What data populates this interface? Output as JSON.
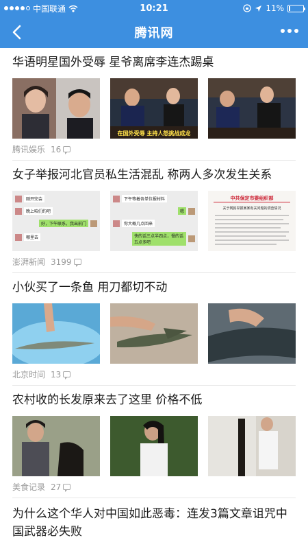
{
  "status_bar": {
    "carrier": "中国联通",
    "time": "10:21",
    "battery": "11%",
    "battery_level": 0.11
  },
  "nav": {
    "title": "腾讯网",
    "back_icon": "chevron-left-icon",
    "more_icon": "more-dots-icon"
  },
  "articles": [
    {
      "headline": "华语明星国外受辱 星爷离席李连杰踢桌",
      "source": "腾讯娱乐",
      "comments": "16"
    },
    {
      "headline": "女子举报河北官员私生活混乱 称两人多次发生关系",
      "source": "澎湃新闻",
      "comments": "3199",
      "chat_lines": [
        "刚开完会",
        "晚上咱们约吧",
        "好，下午联系，我出前门",
        "哪里去",
        "下午等着各单位报材料",
        "嗯",
        "你大概几点回来",
        "快的话三点半四点，慢的话五点多吧"
      ],
      "doc_title": "中共保定市委组织部",
      "doc_subtitle": "关于网民举报某某有关问题的调查情况"
    },
    {
      "headline": "小伙买了一条鱼 用刀都切不动",
      "source": "北京时间",
      "comments": "13"
    },
    {
      "headline": "农村收的长发原来去了这里 价格不低",
      "source": "美食记录",
      "comments": "27"
    },
    {
      "headline": "为什么这个华人对中国如此恶毒：连发3篇文章诅咒中国武器必失败"
    }
  ],
  "caption_overlay": "在国外受辱 主持人怒挑战成龙"
}
